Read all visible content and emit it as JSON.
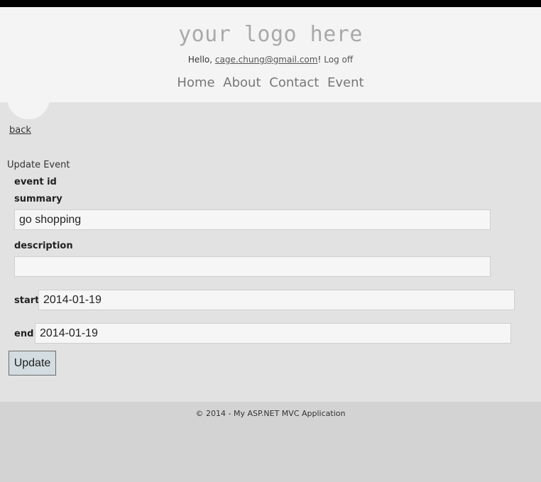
{
  "header": {
    "logo_text": "your logo here",
    "greeting_prefix": "Hello, ",
    "user_email": "cage.chung@gmail.com",
    "greeting_suffix": "!",
    "logoff_label": "Log off"
  },
  "nav": {
    "items": [
      {
        "label": "Home"
      },
      {
        "label": "About"
      },
      {
        "label": "Contact"
      },
      {
        "label": "Event"
      }
    ]
  },
  "page": {
    "back_label": "back",
    "form_title": "Update Event"
  },
  "form": {
    "event_id_label": "event id",
    "summary_label": "summary",
    "summary_value": "go shopping",
    "description_label": "description",
    "description_value": "",
    "start_label": "start",
    "start_value": "2014-01-19",
    "end_label": "end",
    "end_value": "2014-01-19",
    "submit_label": "Update"
  },
  "footer": {
    "copyright": "© 2014 - My ASP.NET MVC Application"
  }
}
